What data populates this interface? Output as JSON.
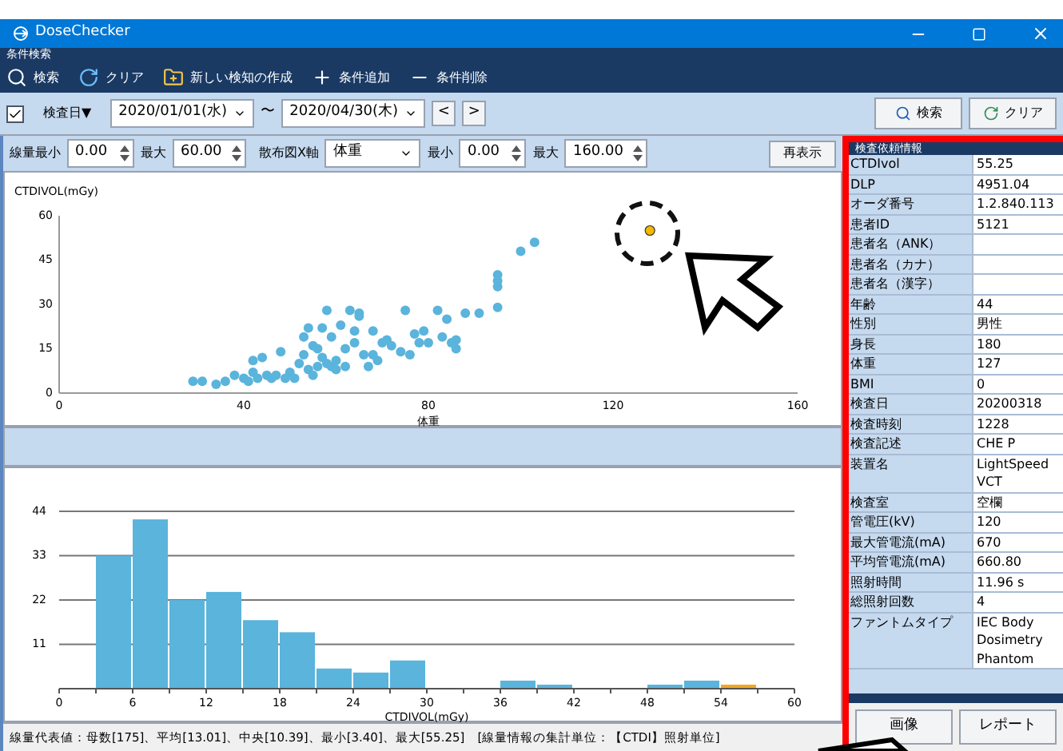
{
  "window": {
    "title": "DoseChecker"
  },
  "toolbar": {
    "section_label": "条件検索",
    "items": [
      {
        "kind": "search",
        "label": "検索"
      },
      {
        "kind": "clear",
        "label": "クリア"
      },
      {
        "kind": "new",
        "label": "新しい検知の作成"
      },
      {
        "kind": "add",
        "label": "条件追加"
      },
      {
        "kind": "remove",
        "label": "条件削除"
      }
    ]
  },
  "filter": {
    "checked": true,
    "field": "検査日▼",
    "date_from": "2020/01/01(水)",
    "separator": "〜",
    "date_to": "2020/04/30(木)",
    "prev": "<",
    "next": ">",
    "search_button": "検索",
    "clear_button": "クリア"
  },
  "controls": {
    "dose_min_label": "線量最小",
    "dose_min": "0.00",
    "dose_max_label": "最大",
    "dose_max": "60.00",
    "x_axis_label": "散布図X軸",
    "x_axis": "体重",
    "x_min_label": "最小",
    "x_min": "0.00",
    "x_max_label": "最大",
    "x_max": "160.00",
    "redraw_button": "再表示"
  },
  "scatter": {
    "chart_data": {
      "type": "scatter",
      "xlabel": "体重",
      "ylabel": "CTDIVOL(mGy)",
      "xlim": [
        0,
        160
      ],
      "ylim": [
        0,
        60
      ],
      "xticks": [
        0,
        40,
        80,
        120,
        160
      ],
      "yticks": [
        0,
        15,
        30,
        45,
        60
      ],
      "series": [
        {
          "color": "#5ab4dc",
          "x": [
            29,
            31,
            34,
            36,
            38,
            40,
            41,
            42,
            42,
            43,
            44,
            45,
            46,
            47,
            48,
            49,
            50,
            51,
            52,
            53,
            53,
            54,
            54,
            55,
            55,
            56,
            56,
            57,
            57,
            58,
            58,
            59,
            59,
            60,
            60,
            61,
            62,
            62,
            63,
            64,
            64,
            65,
            65,
            66,
            67,
            68,
            68,
            69,
            70,
            71,
            72,
            74,
            75,
            76,
            77,
            78,
            79,
            80,
            82,
            83,
            84,
            85,
            86,
            86,
            88,
            91,
            95,
            95,
            95,
            95,
            100,
            103
          ],
          "values": [
            4,
            4,
            3,
            4,
            6,
            5,
            4,
            11,
            7,
            5,
            12,
            6,
            5,
            6,
            14,
            5,
            7,
            5,
            10,
            13,
            19,
            22,
            8,
            16,
            6,
            15,
            9,
            22,
            12,
            28,
            10,
            19,
            9,
            11,
            8,
            23,
            15,
            9,
            28,
            21,
            17,
            27,
            26,
            13,
            9,
            21,
            13,
            11,
            17,
            18,
            16,
            14,
            28,
            13,
            20,
            17,
            21,
            17,
            28,
            19,
            25,
            17,
            18,
            15,
            27,
            27,
            29,
            36,
            38,
            40,
            48,
            51
          ]
        },
        {
          "color": "#f5b800",
          "x": [
            128
          ],
          "values": [
            55
          ]
        }
      ]
    }
  },
  "histogram": {
    "chart_data": {
      "type": "bar",
      "xlabel": "CTDIVOL(mGy)",
      "grid": true,
      "xlim": [
        0,
        60
      ],
      "ylim": [
        0,
        44
      ],
      "xticks": [
        0,
        6,
        12,
        18,
        24,
        30,
        36,
        42,
        48,
        54,
        60
      ],
      "yticks": [
        11,
        22,
        33,
        44
      ],
      "x": [
        4.5,
        7.5,
        10.5,
        13.5,
        16.5,
        19.5,
        22.5,
        25.5,
        28.5,
        31.5,
        34.5,
        37.5,
        40.5,
        43.5,
        46.5,
        49.5,
        52.5,
        55.5
      ],
      "series": [
        {
          "color": "#5ab4dc",
          "values": [
            33,
            42,
            22,
            24,
            17,
            14,
            5,
            4,
            7,
            0,
            0,
            2,
            1,
            0,
            0,
            1,
            2,
            0
          ]
        },
        {
          "color": "#f5a623",
          "values": [
            0,
            0,
            0,
            0,
            0,
            0,
            0,
            0,
            0,
            0,
            0,
            0,
            0,
            0,
            0,
            0,
            0,
            1
          ]
        }
      ]
    }
  },
  "status_bar": "線量代表値：母数[175]、平均[13.01]、中央[10.39]、最小[3.40]、最大[55.25]　[線量情報の集計単位：【CTDI】照射単位]",
  "info_panel": {
    "title": "検査依頼情報",
    "rows": [
      {
        "label": "CTDIvol",
        "value": "55.25"
      },
      {
        "label": "DLP",
        "value": "4951.04"
      },
      {
        "label": "オーダ番号",
        "value": "1.2.840.113"
      },
      {
        "label": "患者ID",
        "value": "5121"
      },
      {
        "label": "患者名（ANK）"
      },
      {
        "label": "患者名（カナ）"
      },
      {
        "label": "患者名（漢字）"
      },
      {
        "label": "年齢",
        "value": "44"
      },
      {
        "label": "性別",
        "value": "男性"
      },
      {
        "label": "身長",
        "value": "180"
      },
      {
        "label": "体重",
        "value": "127"
      },
      {
        "label": "BMI",
        "value": "0"
      },
      {
        "label": "検査日",
        "value": "20200318"
      },
      {
        "label": "検査時刻",
        "value": "1228"
      },
      {
        "label": "検査記述",
        "value": "CHE P"
      },
      {
        "label": "装置名",
        "value": "LightSpeed VCT"
      },
      {
        "label": "検査室",
        "value": "空欄"
      },
      {
        "label": "管電圧(kV)",
        "value": "120"
      },
      {
        "label": "最大管電流(mA)",
        "value": "670"
      },
      {
        "label": "平均管電流(mA)",
        "value": "660.80"
      },
      {
        "label": "照射時間",
        "value": "11.96 s"
      },
      {
        "label": "総照射回数",
        "value": "4"
      },
      {
        "label": "ファントムタイプ",
        "value": "IEC Body Dosimetry Phantom"
      }
    ],
    "buttons": [
      "画像",
      "レポート"
    ]
  }
}
